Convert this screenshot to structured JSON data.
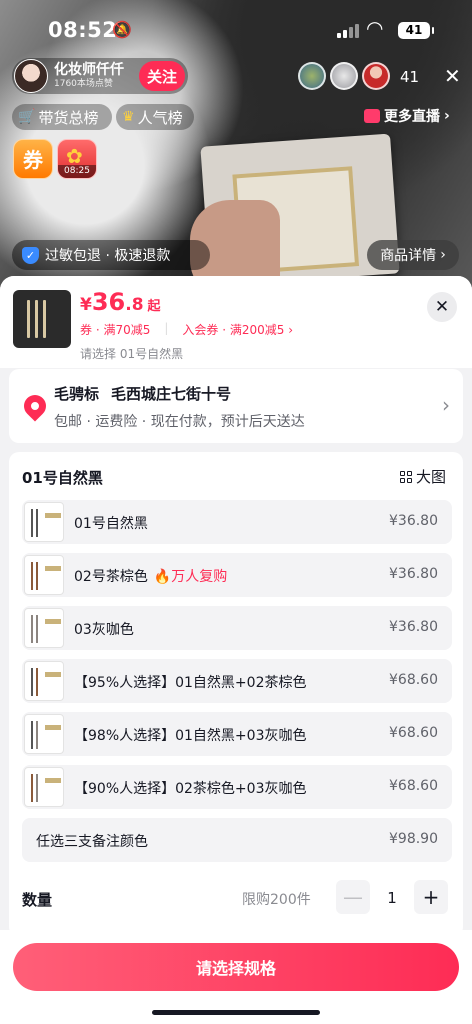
{
  "status_bar": {
    "time": "08:52",
    "battery": "41"
  },
  "live": {
    "anchor_name": "化妆师仟仟",
    "anchor_likes": "1760本场点赞",
    "follow_label": "关注",
    "viewer_count": "41",
    "close_icon": "close-icon",
    "sales_rank": "带货总榜",
    "popularity_rank": "人气榜",
    "more_live": "更多直播",
    "coupon_badge": "券",
    "gift_timer": "08:25",
    "promise": "过敏包退 · 极速退款",
    "product_detail": "商品详情"
  },
  "sku": {
    "currency": "¥",
    "price_int": "36",
    "price_dec": ".8",
    "price_suffix": "起",
    "coupon1": "券 · 满70减5",
    "coupon2": "入会券 · 满200减5 ›",
    "selected_tip": "请选择 01号自然黑",
    "close": "✕"
  },
  "address": {
    "name": "毛骋标",
    "detail": "毛西城庄七街十号",
    "shipping": "包邮 · 运费险 · 现在付款，预计后天送达"
  },
  "spec": {
    "title": "01号自然黑",
    "big_view": "大图",
    "options": [
      {
        "name": "01号自然黑",
        "tag": "",
        "price": "¥36.80"
      },
      {
        "name": "02号茶棕色",
        "tag": "🔥万人复购",
        "price": "¥36.80"
      },
      {
        "name": "03灰咖色",
        "tag": "",
        "price": "¥36.80"
      },
      {
        "name": "【95%人选择】01自然黑+02茶棕色",
        "tag": "",
        "price": "¥68.60"
      },
      {
        "name": "【98%人选择】01自然黑+03灰咖色",
        "tag": "",
        "price": "¥68.60"
      },
      {
        "name": "【90%人选择】02茶棕色+03灰咖色",
        "tag": "",
        "price": "¥68.60"
      },
      {
        "name": "任选三支备注颜色",
        "tag": "",
        "price": "¥98.90"
      }
    ]
  },
  "quantity": {
    "label": "数量",
    "limit": "限购200件",
    "minus": "—",
    "value": "1",
    "plus": "+"
  },
  "cta_label": "请选择规格",
  "colors": {
    "brand": "#fe2c55",
    "sheet_bg": "#f2f2f4"
  }
}
